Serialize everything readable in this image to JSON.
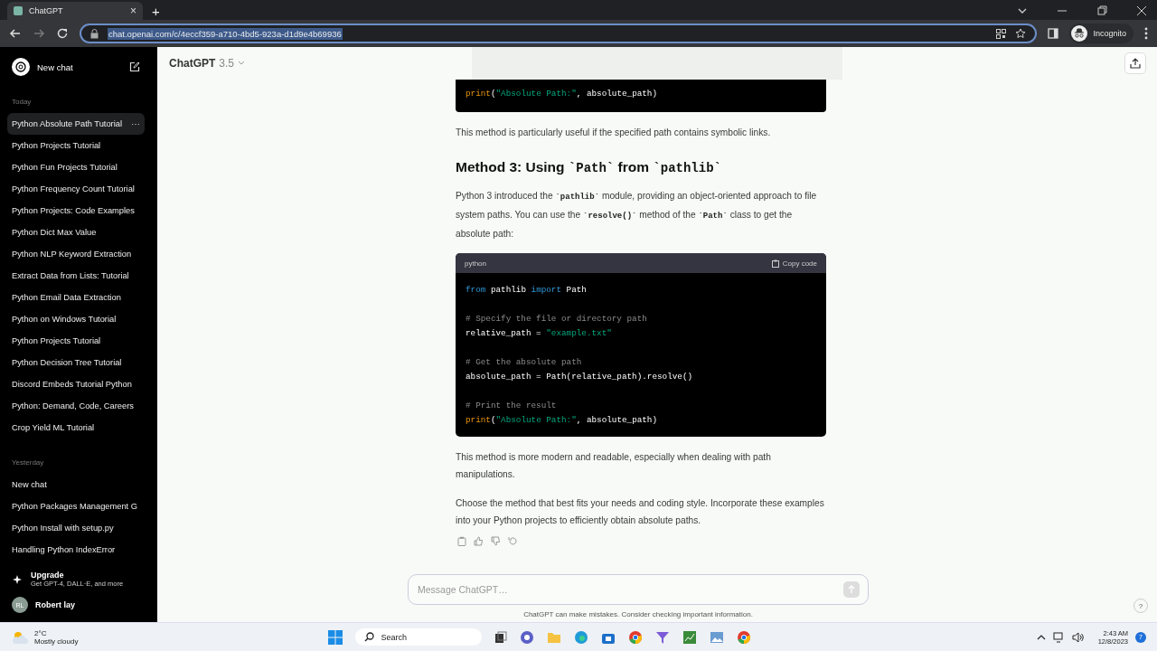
{
  "browser": {
    "tab": {
      "title": "ChatGPT",
      "close": "×"
    },
    "new_tab": "+",
    "url": "chat.openai.com/c/4eccf359-a710-4bd5-923a-d1d9e4b69936",
    "profile": "Incognito"
  },
  "sidebar": {
    "new_chat": "New chat",
    "groups": [
      {
        "label": "Today",
        "items": [
          {
            "title": "Python Absolute Path Tutorial",
            "selected": true,
            "more": "⋯"
          },
          {
            "title": "Python Projects Tutorial",
            "selected": false
          },
          {
            "title": "Python Fun Projects Tutorial",
            "selected": false
          },
          {
            "title": "Python Frequency Count Tutorial",
            "selected": false
          },
          {
            "title": "Python Projects: Code Examples",
            "selected": false
          },
          {
            "title": "Python Dict Max Value",
            "selected": false
          },
          {
            "title": "Python NLP Keyword Extraction",
            "selected": false
          },
          {
            "title": "Extract Data from Lists: Tutorial",
            "selected": false
          },
          {
            "title": "Python Email Data Extraction",
            "selected": false
          },
          {
            "title": "Python on Windows Tutorial",
            "selected": false
          },
          {
            "title": "Python Projects Tutorial",
            "selected": false
          },
          {
            "title": "Python Decision Tree Tutorial",
            "selected": false
          },
          {
            "title": "Discord Embeds Tutorial Python",
            "selected": false
          },
          {
            "title": "Python: Demand, Code, Careers",
            "selected": false
          },
          {
            "title": "Crop Yield ML Tutorial",
            "selected": false
          }
        ]
      },
      {
        "label": "Yesterday",
        "items": [
          {
            "title": "New chat",
            "selected": false
          },
          {
            "title": "Python Packages Management G",
            "selected": false
          },
          {
            "title": "Python Install with setup.py",
            "selected": false
          },
          {
            "title": "Handling Python IndexError",
            "selected": false
          }
        ]
      }
    ],
    "upgrade": {
      "title": "Upgrade",
      "subtitle": "Get GPT-4, DALL·E, and more"
    },
    "user": {
      "initials": "RL",
      "name": "Robert lay"
    }
  },
  "header": {
    "model": "ChatGPT",
    "version": "3.5"
  },
  "top_code": {
    "lines": [
      [
        {
          "text": "print",
          "kind": "func"
        },
        {
          "text": "(",
          "kind": "plain"
        },
        {
          "text": "\"Absolute Path:\"",
          "kind": "string"
        },
        {
          "text": ", absolute_path)",
          "kind": "plain"
        }
      ]
    ]
  },
  "content": [
    {
      "kind": "paragraph",
      "segments": [
        {
          "text": "This method is particularly useful if the specified path contains symbolic links."
        }
      ]
    },
    {
      "kind": "heading",
      "segments": [
        {
          "text": "Method 3: Using "
        },
        {
          "text": "`Path`",
          "code": true
        },
        {
          "text": " from "
        },
        {
          "text": "`pathlib`",
          "code": true
        }
      ]
    },
    {
      "kind": "paragraph",
      "segments": [
        {
          "text": "Python 3 introduced the "
        },
        {
          "text": "`pathlib`",
          "code": true
        },
        {
          "text": " module, providing an object-oriented approach to file system paths. You can use the "
        },
        {
          "text": "`resolve()`",
          "code": true
        },
        {
          "text": " method of the "
        },
        {
          "text": "`Path`",
          "code": true
        },
        {
          "text": " class to get the absolute path:"
        }
      ]
    },
    {
      "kind": "code",
      "language": "python",
      "copy": "Copy code",
      "lines": [
        {
          "tokens": [
            {
              "text": "from",
              "kind": "keyword"
            },
            {
              "text": " pathlib ",
              "kind": "plain"
            },
            {
              "text": "import",
              "kind": "keyword"
            },
            {
              "text": " Path",
              "kind": "plain"
            }
          ]
        },
        {
          "space_before": true,
          "tokens": [
            {
              "text": "# Specify the file or directory path",
              "kind": "comment"
            }
          ]
        },
        {
          "tokens": [
            {
              "text": "relative_path = ",
              "kind": "plain"
            },
            {
              "text": "\"example.txt\"",
              "kind": "string"
            }
          ]
        },
        {
          "space_before": true,
          "tokens": [
            {
              "text": "# Get the absolute path",
              "kind": "comment"
            }
          ]
        },
        {
          "tokens": [
            {
              "text": "absolute_path = Path(relative_path).resolve()",
              "kind": "plain"
            }
          ]
        },
        {
          "space_before": true,
          "tokens": [
            {
              "text": "# Print the result",
              "kind": "comment"
            }
          ]
        },
        {
          "tokens": [
            {
              "text": "print",
              "kind": "func"
            },
            {
              "text": "(",
              "kind": "plain"
            },
            {
              "text": "\"Absolute Path:\"",
              "kind": "string"
            },
            {
              "text": ", absolute_path)",
              "kind": "plain"
            }
          ]
        }
      ]
    },
    {
      "kind": "paragraph",
      "segments": [
        {
          "text": "This method is more modern and readable, especially when dealing with path manipulations."
        }
      ]
    },
    {
      "kind": "paragraph",
      "segments": [
        {
          "text": "Choose the method that best fits your needs and coding style. Incorporate these examples into your Python projects to efficiently obtain absolute paths."
        }
      ]
    }
  ],
  "composer": {
    "placeholder": "Message ChatGPT…",
    "disclaimer": "ChatGPT can make mistakes. Consider checking important information.",
    "help": "?"
  },
  "taskbar": {
    "weather": {
      "temp": "2°C",
      "desc": "Mostly cloudy"
    },
    "search": "Search",
    "time": "2:43 AM",
    "date": "12/8/2023",
    "notifications": "7"
  }
}
